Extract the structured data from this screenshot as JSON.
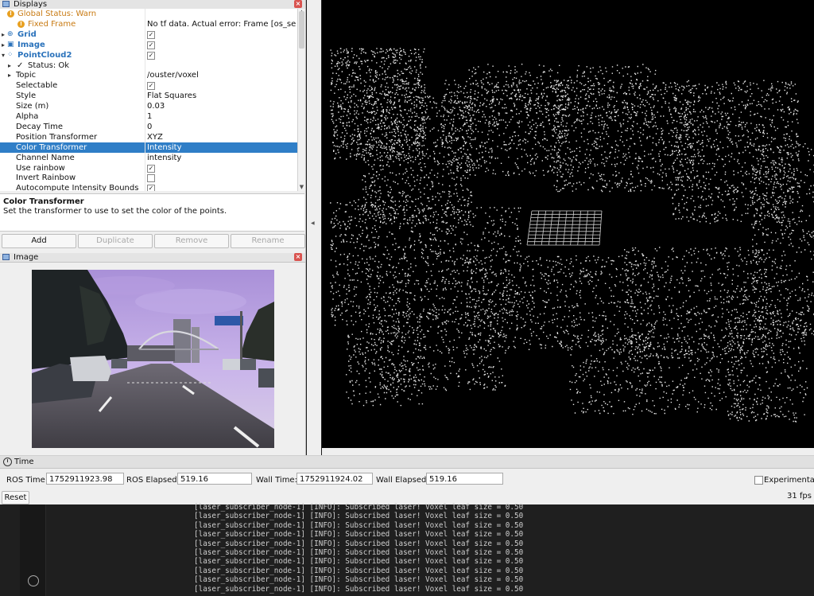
{
  "displays": {
    "title": "Displays",
    "tree": [
      {
        "label": "Global Status: Warn",
        "value": "",
        "kind": "warn",
        "indent": 0
      },
      {
        "label": "Fixed Frame",
        "value": "No tf data.  Actual error: Frame [os_se…",
        "kind": "warn",
        "indent": 1
      },
      {
        "label": "Grid",
        "value": "",
        "kind": "display",
        "icon": "grid-icon",
        "checked": true
      },
      {
        "label": "Image",
        "value": "",
        "kind": "display",
        "icon": "image-icon",
        "checked": true
      },
      {
        "label": "PointCloud2",
        "value": "",
        "kind": "display",
        "icon": "pointcloud-icon",
        "checked": true
      },
      {
        "label": "Status: Ok",
        "value": "",
        "kind": "status"
      },
      {
        "label": "Topic",
        "value": "/ouster/voxel",
        "kind": "prop",
        "expandable": true
      },
      {
        "label": "Selectable",
        "value": "",
        "kind": "prop",
        "checked": true
      },
      {
        "label": "Style",
        "value": "Flat Squares",
        "kind": "prop"
      },
      {
        "label": "Size (m)",
        "value": "0.03",
        "kind": "prop"
      },
      {
        "label": "Alpha",
        "value": "1",
        "kind": "prop"
      },
      {
        "label": "Decay Time",
        "value": "0",
        "kind": "prop"
      },
      {
        "label": "Position Transformer",
        "value": "XYZ",
        "kind": "prop"
      },
      {
        "label": "Color Transformer",
        "value": "Intensity",
        "kind": "prop",
        "selected": true
      },
      {
        "label": "Channel Name",
        "value": "intensity",
        "kind": "prop"
      },
      {
        "label": "Use rainbow",
        "value": "",
        "kind": "prop",
        "checked": true
      },
      {
        "label": "Invert Rainbow",
        "value": "",
        "kind": "prop",
        "checked": false
      },
      {
        "label": "Autocompute Intensity Bounds",
        "value": "",
        "kind": "prop",
        "checked": true
      }
    ],
    "description_title": "Color Transformer",
    "description_text": "Set the transformer to use to set the color of the points.",
    "buttons": {
      "add": "Add",
      "duplicate": "Duplicate",
      "remove": "Remove",
      "rename": "Rename"
    }
  },
  "image_panel": {
    "title": "Image"
  },
  "time_panel": {
    "title": "Time",
    "ros_time_label": "ROS Time:",
    "ros_time": "1752911923.98",
    "ros_elapsed_label": "ROS Elapsed:",
    "ros_elapsed": "519.16",
    "wall_time_label": "Wall Time:",
    "wall_time": "1752911924.02",
    "wall_elapsed_label": "Wall Elapsed:",
    "wall_elapsed": "519.16",
    "experimental_label": "Experimental",
    "reset_label": "Reset",
    "fps": "31 fps"
  },
  "terminal": {
    "lines": [
      "[laser_subscriber_node-1] [INFO]: Subscribed laser! Voxel leaf size = 0.50",
      "[laser_subscriber_node-1] [INFO]: Subscribed laser! Voxel leaf size = 0.50",
      "[laser_subscriber_node-1] [INFO]: Subscribed laser! Voxel leaf size = 0.50",
      "[laser_subscriber_node-1] [INFO]: Subscribed laser! Voxel leaf size = 0.50",
      "[laser_subscriber_node-1] [INFO]: Subscribed laser! Voxel leaf size = 0.50",
      "[laser_subscriber_node-1] [INFO]: Subscribed laser! Voxel leaf size = 0.50",
      "[laser_subscriber_node-1] [INFO]: Subscribed laser! Voxel leaf size = 0.50",
      "[laser_subscriber_node-1] [INFO]: Subscribed laser! Voxel leaf size = 0.50",
      "[laser_subscriber_node-1] [INFO]: Subscribed laser! Voxel leaf size = 0.50",
      "[laser_subscriber_node-1] [INFO]: Subscribed laser! Voxel leaf size = 0.50"
    ]
  },
  "colors": {
    "selection": "#2f7ec7",
    "warn": "#e8a020",
    "display_label": "#2a72bb"
  }
}
